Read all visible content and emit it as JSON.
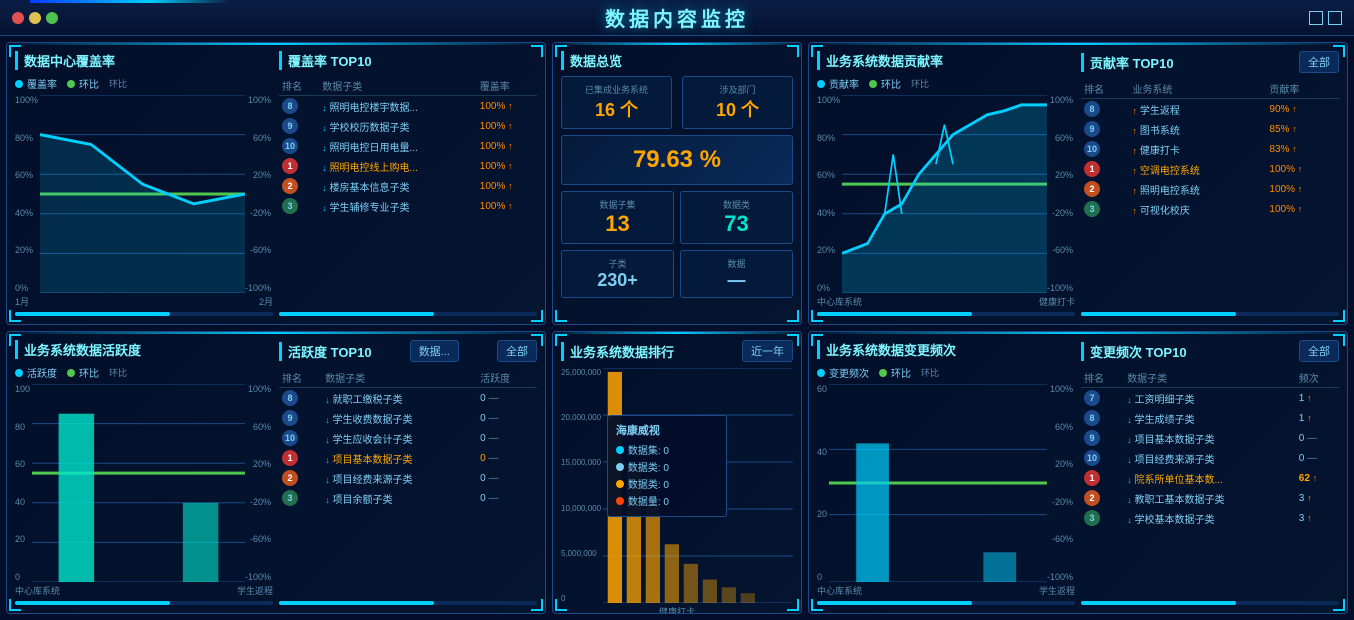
{
  "app": {
    "title": "数据内容监控",
    "window_dots": [
      "red",
      "yellow",
      "green"
    ]
  },
  "panels": {
    "coverage": {
      "title": "数据中心覆盖率",
      "top10_title": "覆盖率 TOP10",
      "legend": {
        "rate": "覆盖率",
        "ring": "环比"
      },
      "y_axis": [
        "100%",
        "80%",
        "60%",
        "40%",
        "20%",
        "0%"
      ],
      "y_axis_right": [
        "100%",
        "60%",
        "20%",
        "-20%",
        "-60%",
        "-100%"
      ],
      "x_axis": [
        "1月",
        "2月"
      ],
      "columns": [
        "排名",
        "数据子类",
        "覆盖率"
      ],
      "rows": [
        {
          "rank": "8",
          "rank_type": "blue",
          "name": "照明电控楼宇数据...",
          "value": "100%",
          "arrow": "up"
        },
        {
          "rank": "9",
          "rank_type": "blue",
          "name": "学校校历数据子类",
          "value": "100%",
          "arrow": "up"
        },
        {
          "rank": "10",
          "rank_type": "blue",
          "name": "照明电控日用电量...",
          "value": "100%",
          "arrow": "up"
        },
        {
          "rank": "1",
          "rank_type": "red",
          "name": "照明电控线上购电...",
          "value": "100%",
          "arrow": "up"
        },
        {
          "rank": "2",
          "rank_type": "orange",
          "name": "楼房基本信息子类",
          "value": "100%",
          "arrow": "up"
        },
        {
          "rank": "3",
          "rank_type": "green",
          "name": "学生辅修专业子类",
          "value": "100%",
          "arrow": "up"
        }
      ]
    },
    "data_overview": {
      "title": "数据总览",
      "systems_label": "已集成业务系统",
      "systems_value": "16 个",
      "dept_label": "涉及部门",
      "dept_value": "10 个",
      "pct": "79.63 %",
      "dataset_label": "数据子集",
      "dataset_value": "13",
      "datatype_label": "数据类",
      "datatype_value": "73",
      "subtype_label": "子类",
      "data_label": "数据",
      "subtype_value": "230+"
    },
    "business_coverage": {
      "title": "业务系统数据贡献率",
      "top10_title": "贡献率 TOP10",
      "legend": {
        "rate": "贡献率",
        "ring": "环比"
      },
      "y_axis": [
        "100%",
        "80%",
        "60%",
        "40%",
        "20%",
        "0%"
      ],
      "y_axis_right": [
        "100%",
        "60%",
        "20%",
        "-20%",
        "-60%",
        "-100%"
      ],
      "x_axis": [
        "中心库系统",
        "健康打卡"
      ],
      "dropdown": "全部",
      "columns": [
        "排名",
        "业务系统",
        "贡献率"
      ],
      "rows": [
        {
          "rank": "8",
          "rank_type": "blue",
          "name": "学生返程",
          "value": "90%",
          "arrow": "up"
        },
        {
          "rank": "9",
          "rank_type": "blue",
          "name": "图书系统",
          "value": "85%",
          "arrow": "up"
        },
        {
          "rank": "10",
          "rank_type": "blue",
          "name": "健康打卡",
          "value": "83%",
          "arrow": "up"
        },
        {
          "rank": "1",
          "rank_type": "red",
          "name": "空调电控系统",
          "value": "100%",
          "arrow": "up"
        },
        {
          "rank": "2",
          "rank_type": "orange",
          "name": "照明电控系统",
          "value": "100%",
          "arrow": "up"
        },
        {
          "rank": "3",
          "rank_type": "green",
          "name": "可视化校庆",
          "value": "100%",
          "arrow": "up"
        }
      ]
    },
    "activity": {
      "title": "业务系统数据活跃度",
      "top10_title": "活跃度 TOP10",
      "legend": {
        "rate": "活跃度",
        "ring": "环比"
      },
      "y_axis": [
        "100",
        "80",
        "60",
        "40",
        "20",
        "0"
      ],
      "y_axis_right": [
        "100%",
        "60%",
        "20%",
        "-20%",
        "-60%",
        "-100%"
      ],
      "x_axis": [
        "中心库系统",
        "学生返程"
      ],
      "dropdown1": "数据...",
      "dropdown2": "全部",
      "columns": [
        "排名",
        "数据子类",
        "活跃度"
      ],
      "rows": [
        {
          "rank": "8",
          "rank_type": "blue",
          "name": "就职工缴税子类",
          "value": "0",
          "arrow": "dash"
        },
        {
          "rank": "9",
          "rank_type": "blue",
          "name": "学生收费数据子类",
          "value": "0",
          "arrow": "dash"
        },
        {
          "rank": "10",
          "rank_type": "blue",
          "name": "学生应收会计子类",
          "value": "0",
          "arrow": "dash"
        },
        {
          "rank": "1",
          "rank_type": "red",
          "name": "项目基本数据子类",
          "value": "0",
          "arrow": "dash",
          "highlight": true
        },
        {
          "rank": "2",
          "rank_type": "orange",
          "name": "项目经费来源子类",
          "value": "0",
          "arrow": "dash"
        },
        {
          "rank": "3",
          "rank_type": "green",
          "name": "项目余额子类",
          "value": "0",
          "arrow": "dash"
        }
      ]
    },
    "business_ranking": {
      "title": "业务系统数据排行",
      "dropdown": "近一年",
      "y_axis": [
        "25,000,000",
        "20,000,000",
        "15,000,000",
        "10,000,000",
        "5,000,000",
        "0"
      ],
      "x_axis": "健康打卡",
      "tooltip": {
        "title": "海康威视",
        "items": [
          {
            "color": "#00cfff",
            "label": "数据集:",
            "value": "0"
          },
          {
            "color": "#7ecef4",
            "label": "数据类:",
            "value": "0"
          },
          {
            "color": "#ffa500",
            "label": "数据类:",
            "value": "0"
          },
          {
            "color": "#ff4500",
            "label": "数据量:",
            "value": "0"
          }
        ]
      }
    },
    "change_freq": {
      "title": "业务系统数据变更频次",
      "top10_title": "变更频次 TOP10",
      "legend": {
        "rate": "变更频次",
        "ring": "环比"
      },
      "y_axis": [
        "60",
        "40",
        "20",
        "0"
      ],
      "y_axis_right": [
        "100%",
        "60%",
        "20%",
        "-20%",
        "-60%",
        "-100%"
      ],
      "x_axis": [
        "中心库系统",
        "学生返程"
      ],
      "dropdown": "全部",
      "columns": [
        "排名",
        "数据子类",
        "频次"
      ],
      "rows": [
        {
          "rank": "7",
          "rank_type": "blue",
          "name": "工资明细子类",
          "value": "1",
          "arrow": "up"
        },
        {
          "rank": "8",
          "rank_type": "blue",
          "name": "学生成绩子类",
          "value": "1",
          "arrow": "up"
        },
        {
          "rank": "9",
          "rank_type": "blue",
          "name": "项目基本数据子类",
          "value": "0",
          "arrow": "dash"
        },
        {
          "rank": "10",
          "rank_type": "blue",
          "name": "项目经费来源子类",
          "value": "0",
          "arrow": "dash"
        },
        {
          "rank": "1",
          "rank_type": "red",
          "name": "院系所单位基本数...",
          "value": "62",
          "arrow": "up"
        },
        {
          "rank": "2",
          "rank_type": "orange",
          "name": "教职工基本数据子类",
          "value": "3",
          "arrow": "up"
        },
        {
          "rank": "3",
          "rank_type": "green",
          "name": "学校基本数据子类",
          "value": "3",
          "arrow": "up"
        }
      ]
    }
  },
  "colors": {
    "cyan": "#00cfff",
    "orange": "#ffa500",
    "teal": "#00e5cc",
    "blue": "#7ecef4",
    "dark_blue": "#041a3a",
    "border": "#1a4a8a",
    "accent": "#00cfff"
  }
}
